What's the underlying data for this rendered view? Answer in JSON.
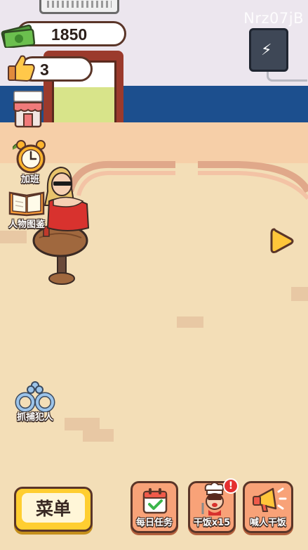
{
  "hud": {
    "cash_value": "1850",
    "likes_value": "3",
    "watermark": "Nrz07jB"
  },
  "side_buttons": {
    "overtime_label": "加班",
    "character_book_label": "人物图鉴",
    "arrest_label": "抓捕犯人",
    "shop_icon": "shop-icon",
    "clock_icon": "alarm-clock-icon",
    "book_icon": "book-icon",
    "handcuffs_icon": "handcuffs-icon"
  },
  "bottom_bar": {
    "menu_label": "菜单",
    "daily_tasks_label": "每日任务",
    "eat_label": "干饭x15",
    "call_label": "喊人干饭",
    "notification_badge": "!"
  },
  "colors": {
    "accent_yellow": "#ffce31",
    "button_orange": "#f8a278",
    "outline_brown": "#5a3528",
    "wall_blue": "#1c4f8e",
    "floor": "#f3deb7"
  }
}
